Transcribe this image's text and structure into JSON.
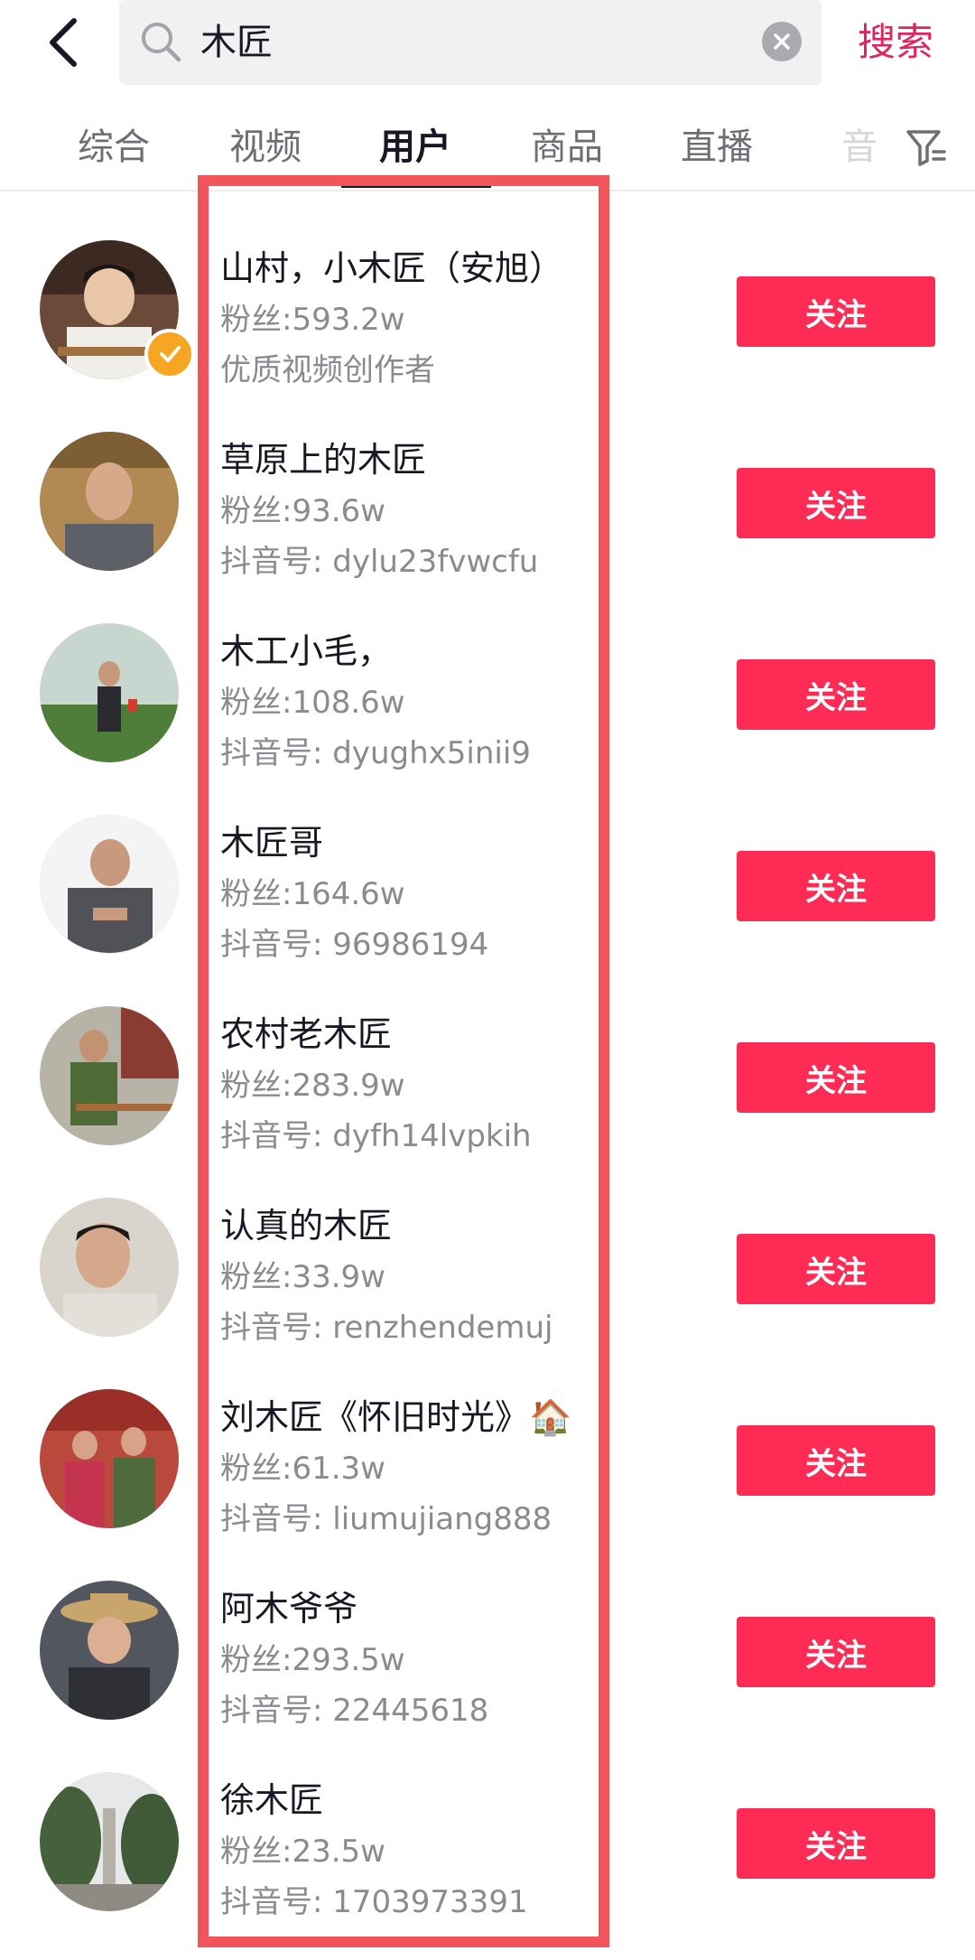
{
  "header": {
    "search_query": "木匠",
    "search_button": "搜索"
  },
  "tabs": [
    {
      "label": "综合"
    },
    {
      "label": "视频"
    },
    {
      "label": "用户"
    },
    {
      "label": "商品"
    },
    {
      "label": "直播"
    },
    {
      "label": "音"
    }
  ],
  "active_tab": "用户",
  "follow_label": "关注",
  "users": [
    {
      "name": "山村，小木匠（安旭）",
      "fans": "粉丝:593.2w",
      "sub": "优质视频创作者",
      "verified": true
    },
    {
      "name": "草原上的木匠",
      "fans": "粉丝:93.6w",
      "sub": "抖音号: dylu23fvwcfu",
      "verified": false
    },
    {
      "name": "木工小毛，",
      "fans": "粉丝:108.6w",
      "sub": "抖音号: dyughx5inii9",
      "verified": false
    },
    {
      "name": "木匠哥",
      "fans": "粉丝:164.6w",
      "sub": "抖音号: 96986194",
      "verified": false
    },
    {
      "name": "农村老木匠",
      "fans": "粉丝:283.9w",
      "sub": "抖音号: dyfh14lvpkih",
      "verified": false
    },
    {
      "name": "认真的木匠",
      "fans": "粉丝:33.9w",
      "sub": "抖音号: renzhendemuj",
      "verified": false
    },
    {
      "name": "刘木匠《怀旧时光》🏠",
      "fans": "粉丝:61.3w",
      "sub": "抖音号: liumujiang888",
      "verified": false
    },
    {
      "name": "阿木爷爷",
      "fans": "粉丝:293.5w",
      "sub": "抖音号: 22445618",
      "verified": false
    },
    {
      "name": "徐木匠",
      "fans": "粉丝:23.5w",
      "sub": "抖音号: 1703973391",
      "verified": false
    }
  ],
  "colors": {
    "accent": "#fe2c55",
    "search_accent": "#e0245e",
    "highlight": "#f2545b",
    "verified": "#f6a623"
  }
}
